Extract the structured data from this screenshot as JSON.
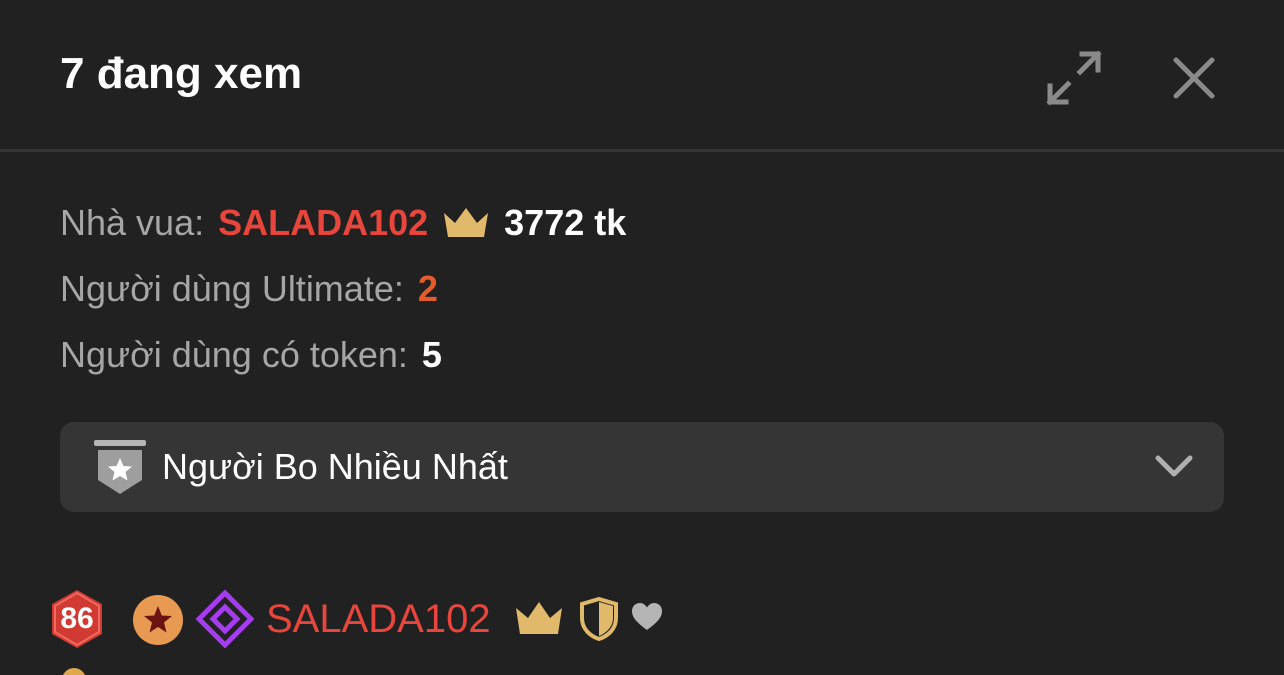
{
  "header": {
    "title": "7 đang xem",
    "expand_icon": "expand-icon",
    "close_icon": "close-icon"
  },
  "stats": {
    "king_label": "Nhà vua:",
    "king_name": "SALADA102",
    "king_tokens": "3772 tk",
    "ultimate_label": "Người dùng Ultimate:",
    "ultimate_count": "2",
    "token_users_label": "Người dùng có token:",
    "token_users_count": "5"
  },
  "dropdown": {
    "icon": "star-shield-icon",
    "selected_label": "Người Bo Nhiều Nhất",
    "chevron_icon": "chevron-down-icon"
  },
  "users": [
    {
      "level": "86",
      "name": "SALADA102",
      "icons": [
        "star-badge-icon",
        "diamond-icon",
        "crown-icon",
        "shield-icon",
        "heart-icon"
      ]
    }
  ],
  "colors": {
    "background": "#212121",
    "accent_red": "#e8463c",
    "accent_orange": "#e45c2c",
    "gold": "#e0b96a",
    "muted_text": "#a6a6a6",
    "dropdown_bg": "#353535",
    "diamond_purple": "#a63cf0"
  }
}
